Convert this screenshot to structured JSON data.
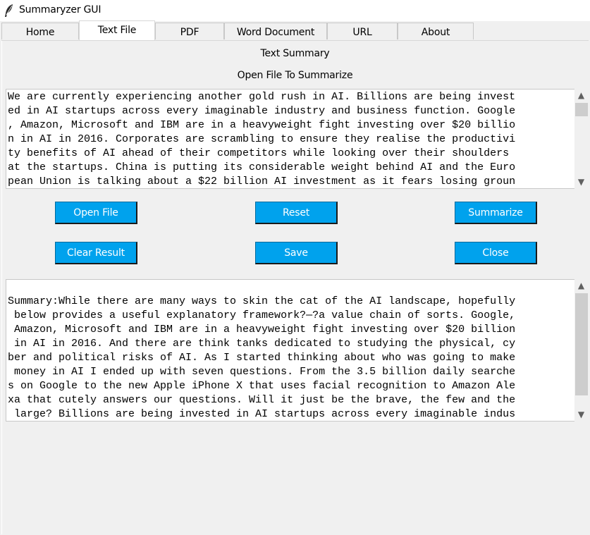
{
  "window": {
    "title": "Summaryzer GUI",
    "icon": "feather-icon"
  },
  "tabs": [
    {
      "label": "Home"
    },
    {
      "label": "Text File",
      "active": true
    },
    {
      "label": "PDF"
    },
    {
      "label": "Word Document"
    },
    {
      "label": "URL"
    },
    {
      "label": "About"
    }
  ],
  "main": {
    "heading": "Text Summary",
    "subheading": "Open File To Summarize",
    "input_text": "We are currently experiencing another gold rush in AI. Billions are being invest\ned in AI startups across every imaginable industry and business function. Google\n, Amazon, Microsoft and IBM are in a heavyweight fight investing over $20 billio\nn in AI in 2016. Corporates are scrambling to ensure they realise the productivi\nty benefits of AI ahead of their competitors while looking over their shoulders \nat the startups. China is putting its considerable weight behind AI and the Euro\npean Union is talking about a $22 billion AI investment as it fears losing groun",
    "buttons": {
      "open_file": "Open File",
      "reset": "Reset",
      "summarize": "Summarize",
      "clear_result": "Clear Result",
      "save": "Save",
      "close": "Close"
    },
    "result_text": "\nSummary:While there are many ways to skin the cat of the AI landscape, hopefully\n below provides a useful explanatory framework?—?a value chain of sorts. Google,\n Amazon, Microsoft and IBM are in a heavyweight fight investing over $20 billion\n in AI in 2016. And there are think tanks dedicated to studying the physical, cy\nber and political risks of AI. As I started thinking about who was going to make\n money in AI I ended up with seven questions. From the 3.5 billion daily searche\ns on Google to the new Apple iPhone X that uses facial recognition to Amazon Ale\nxa that cutely answers our questions. Will it just be the brave, the few and the\n large? Billions are being invested in AI startups across every imaginable indus"
  },
  "colors": {
    "button_bg": "#00a2ed",
    "button_text": "#ffffff",
    "panel_bg": "#f0f0f0"
  }
}
